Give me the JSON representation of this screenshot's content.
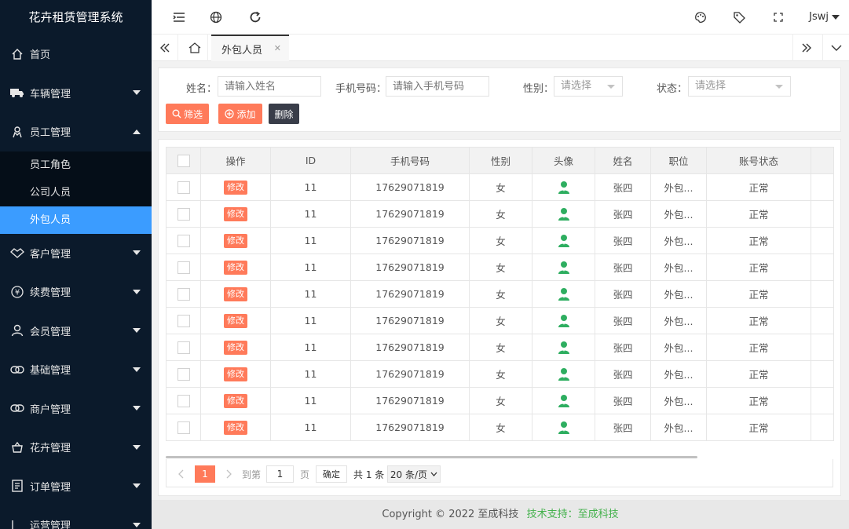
{
  "app": {
    "title": "花卉租赁管理系统"
  },
  "sidebar": {
    "items": [
      {
        "label": "首页",
        "icon": "home-icon",
        "expandable": false
      },
      {
        "label": "车辆管理",
        "icon": "truck-icon",
        "expandable": true
      },
      {
        "label": "员工管理",
        "icon": "employee-icon",
        "expandable": true,
        "expanded": true,
        "children": [
          {
            "label": "员工角色"
          },
          {
            "label": "公司人员"
          },
          {
            "label": "外包人员",
            "active": true
          }
        ]
      },
      {
        "label": "客户管理",
        "icon": "handshake-icon",
        "expandable": true
      },
      {
        "label": "续费管理",
        "icon": "yen-icon",
        "expandable": true
      },
      {
        "label": "会员管理",
        "icon": "user-icon",
        "expandable": true
      },
      {
        "label": "基础管理",
        "icon": "link-icon",
        "expandable": true
      },
      {
        "label": "商户管理",
        "icon": "link-icon",
        "expandable": true
      },
      {
        "label": "花卉管理",
        "icon": "basket-icon",
        "expandable": true
      },
      {
        "label": "订单管理",
        "icon": "order-icon",
        "expandable": true
      },
      {
        "label": "运营管理",
        "icon": "chart-icon",
        "expandable": true
      }
    ]
  },
  "header": {
    "user": "Jswj"
  },
  "tabs": {
    "active": "外包人员"
  },
  "filters": {
    "name_label": "姓名：",
    "name_placeholder": "请输入姓名",
    "phone_label": "手机号码：",
    "phone_placeholder": "请输入手机号码",
    "gender_label": "性别：",
    "gender_value": "请选择",
    "status_label": "状态：",
    "status_value": "请选择",
    "filter_btn": "筛选",
    "add_btn": "添加",
    "delete_btn": "删除"
  },
  "table": {
    "headers": [
      "操作",
      "ID",
      "手机号码",
      "性别",
      "头像",
      "姓名",
      "职位",
      "账号状态"
    ],
    "rows": [
      {
        "action": "修改",
        "id": "11",
        "phone": "17629071819",
        "gender": "女",
        "name": "张四",
        "position": "外包...",
        "status": "正常"
      },
      {
        "action": "修改",
        "id": "11",
        "phone": "17629071819",
        "gender": "女",
        "name": "张四",
        "position": "外包...",
        "status": "正常"
      },
      {
        "action": "修改",
        "id": "11",
        "phone": "17629071819",
        "gender": "女",
        "name": "张四",
        "position": "外包...",
        "status": "正常"
      },
      {
        "action": "修改",
        "id": "11",
        "phone": "17629071819",
        "gender": "女",
        "name": "张四",
        "position": "外包...",
        "status": "正常"
      },
      {
        "action": "修改",
        "id": "11",
        "phone": "17629071819",
        "gender": "女",
        "name": "张四",
        "position": "外包...",
        "status": "正常"
      },
      {
        "action": "修改",
        "id": "11",
        "phone": "17629071819",
        "gender": "女",
        "name": "张四",
        "position": "外包...",
        "status": "正常"
      },
      {
        "action": "修改",
        "id": "11",
        "phone": "17629071819",
        "gender": "女",
        "name": "张四",
        "position": "外包...",
        "status": "正常"
      },
      {
        "action": "修改",
        "id": "11",
        "phone": "17629071819",
        "gender": "女",
        "name": "张四",
        "position": "外包...",
        "status": "正常"
      },
      {
        "action": "修改",
        "id": "11",
        "phone": "17629071819",
        "gender": "女",
        "name": "张四",
        "position": "外包...",
        "status": "正常"
      },
      {
        "action": "修改",
        "id": "11",
        "phone": "17629071819",
        "gender": "女",
        "name": "张四",
        "position": "外包...",
        "status": "正常"
      }
    ]
  },
  "pagination": {
    "current": "1",
    "goto_label": "到第",
    "page_input": "1",
    "page_unit": "页",
    "confirm": "确定",
    "total": "共 1 条",
    "page_size": "20 条/页"
  },
  "footer": {
    "copyright": "Copyright © 2022  至成科技",
    "support": "技术支持：至成科技"
  },
  "colors": {
    "sidebar_bg": "#0b1a2b",
    "active_blue": "#3b9cff",
    "accent_orange": "#ff7a5a",
    "avatar_green": "#2eae60",
    "support_green": "#43b14b"
  }
}
